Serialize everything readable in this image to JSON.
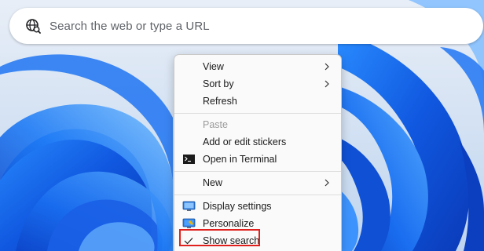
{
  "search": {
    "placeholder": "Search the web or type a URL",
    "icon": "globe-search-icon"
  },
  "context_menu": {
    "items": [
      {
        "label": "View",
        "submenu": true,
        "enabled": true
      },
      {
        "label": "Sort by",
        "submenu": true,
        "enabled": true
      },
      {
        "label": "Refresh",
        "enabled": true
      },
      {
        "label": "Paste",
        "enabled": false
      },
      {
        "label": "Add or edit stickers",
        "enabled": true
      },
      {
        "label": "Open in Terminal",
        "icon": "terminal-icon",
        "enabled": true
      },
      {
        "label": "New",
        "submenu": true,
        "enabled": true
      },
      {
        "label": "Display settings",
        "icon": "display-icon",
        "enabled": true
      },
      {
        "label": "Personalize",
        "icon": "personalize-icon",
        "enabled": true
      },
      {
        "label": "Show search",
        "icon": "checkmark-icon",
        "checked": true,
        "enabled": true
      }
    ]
  },
  "colors": {
    "highlight": "#e0201c",
    "wallpaper_blue": "#1560e6",
    "wallpaper_bg": "#cfdff2"
  }
}
